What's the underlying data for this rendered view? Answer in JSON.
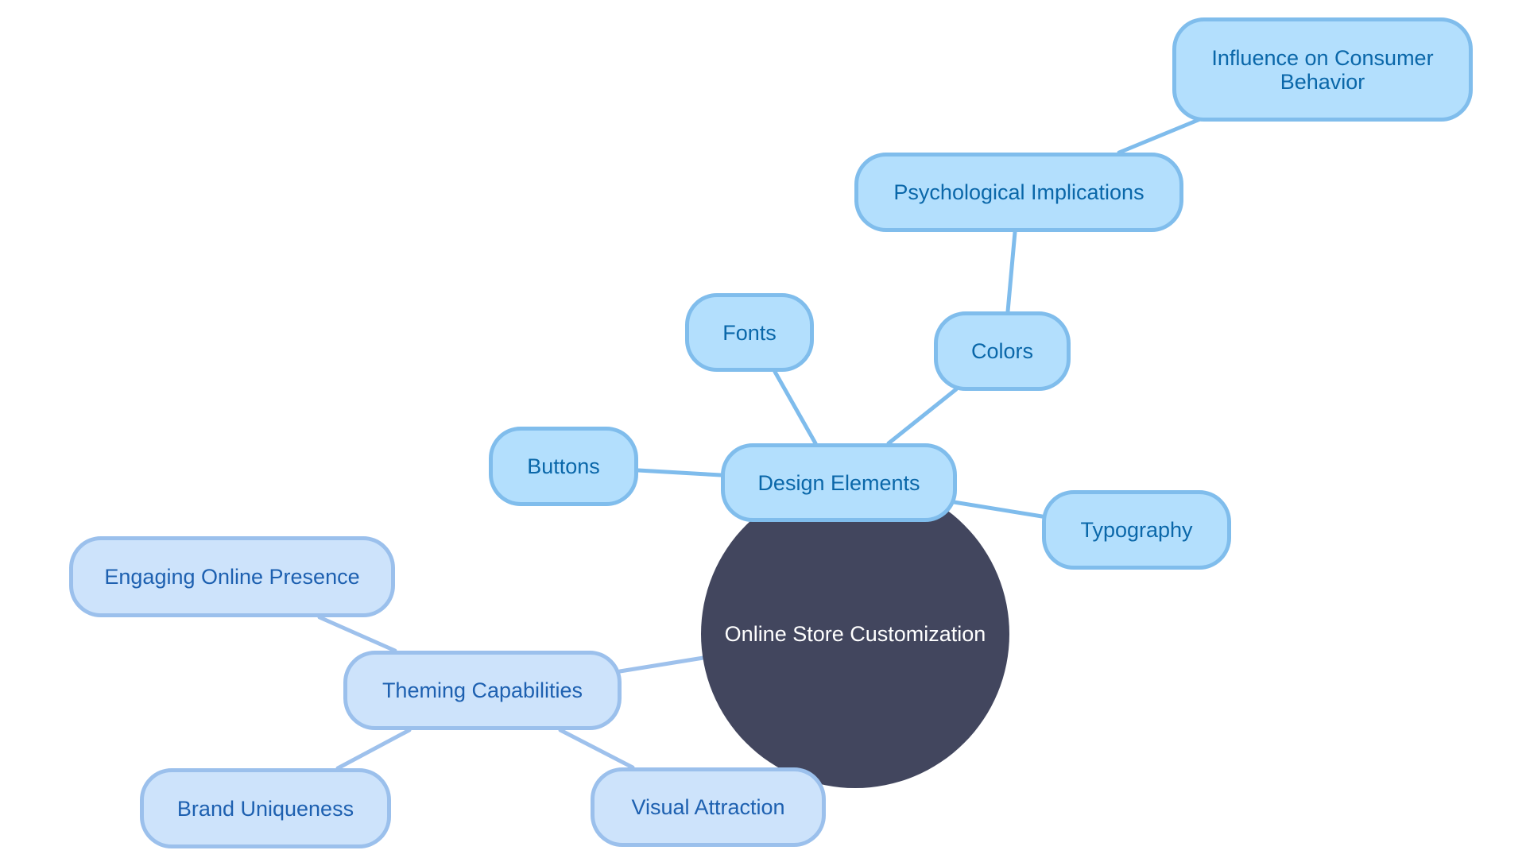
{
  "diagram": {
    "type": "mindmap",
    "root": {
      "id": "root",
      "label": "Online Store Customization"
    },
    "nodes": [
      {
        "id": "design",
        "label": "Design Elements",
        "parent": "root",
        "style": "a"
      },
      {
        "id": "buttons",
        "label": "Buttons",
        "parent": "design",
        "style": "a"
      },
      {
        "id": "fonts",
        "label": "Fonts",
        "parent": "design",
        "style": "a"
      },
      {
        "id": "colors",
        "label": "Colors",
        "parent": "design",
        "style": "a"
      },
      {
        "id": "psych",
        "label": "Psychological Implications",
        "parent": "colors",
        "style": "a"
      },
      {
        "id": "influence",
        "label": "Influence on Consumer Behavior",
        "parent": "psych",
        "style": "a"
      },
      {
        "id": "typography",
        "label": "Typography",
        "parent": "design",
        "style": "a"
      },
      {
        "id": "theming",
        "label": "Theming Capabilities",
        "parent": "root",
        "style": "b"
      },
      {
        "id": "engaging",
        "label": "Engaging Online Presence",
        "parent": "theming",
        "style": "b"
      },
      {
        "id": "brand",
        "label": "Brand Uniqueness",
        "parent": "theming",
        "style": "b"
      },
      {
        "id": "visual",
        "label": "Visual Attraction",
        "parent": "theming",
        "style": "b"
      }
    ],
    "colors": {
      "root_fill": "#42465e",
      "branch_a_fill": "#b3dffd",
      "branch_a_stroke": "#80bdec",
      "branch_a_text": "#0a67a9",
      "branch_b_fill": "#cde3fb",
      "branch_b_stroke": "#9bc0ec",
      "branch_b_text": "#1d60b0"
    }
  }
}
